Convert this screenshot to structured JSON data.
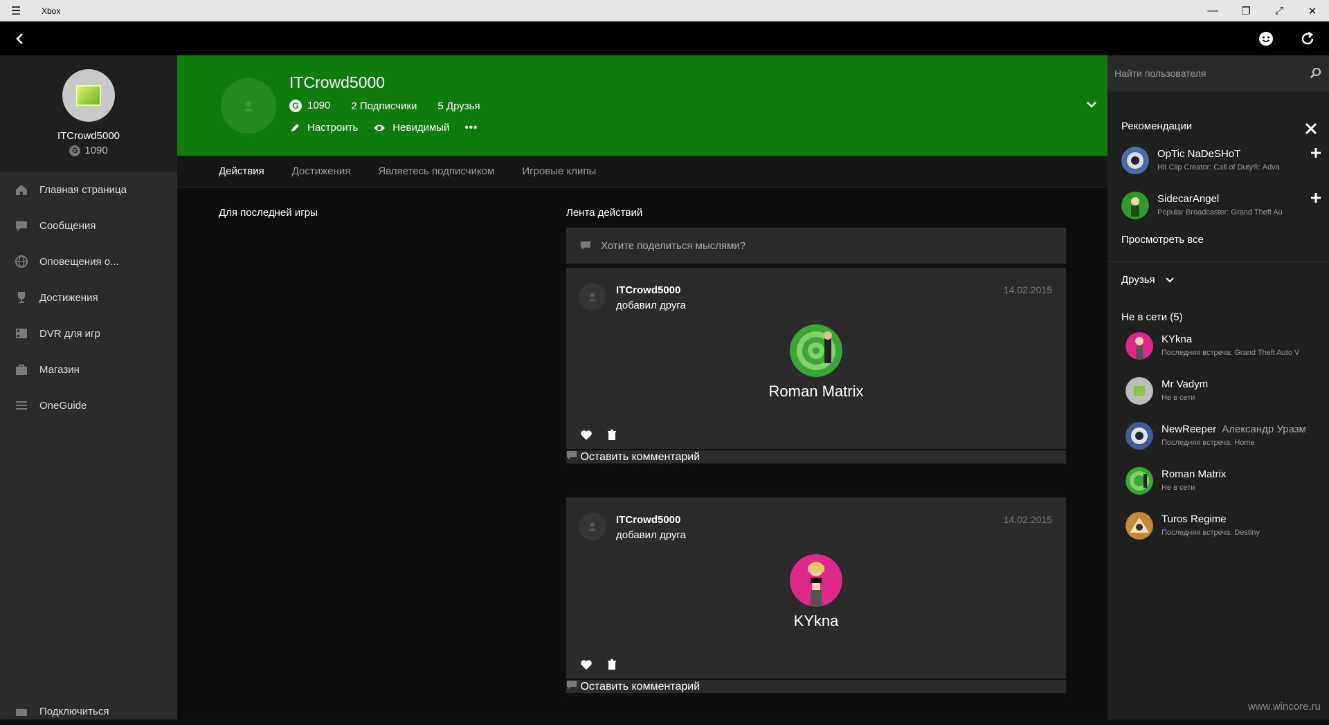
{
  "window": {
    "title": "Xbox",
    "controls": [
      "minimize",
      "restore",
      "maximize",
      "close"
    ]
  },
  "appbar": {
    "icons": [
      "back-icon",
      "smiley-icon",
      "refresh-icon"
    ]
  },
  "profile": {
    "gamertag": "ITCrowd5000",
    "gamerscore": "1090",
    "g_symbol": "G"
  },
  "nav": [
    {
      "label": "Главная страница",
      "icon": "home-icon"
    },
    {
      "label": "Сообщения",
      "icon": "message-icon"
    },
    {
      "label": "Оповещения о...",
      "icon": "globe-icon"
    },
    {
      "label": "Достижения",
      "icon": "trophy-icon"
    },
    {
      "label": "DVR для игр",
      "icon": "dvr-icon"
    },
    {
      "label": "Магазин",
      "icon": "store-icon"
    },
    {
      "label": "OneGuide",
      "icon": "guide-icon"
    }
  ],
  "nav_bottom": {
    "label": "Подключиться"
  },
  "banner": {
    "gamertag": "ITCrowd5000",
    "gamerscore": "1090",
    "followers": "2 Подписчики",
    "friends": "5 Друзья",
    "customize": "Настроить",
    "presence": "Невидимый",
    "more": "•••",
    "color": "#107c10"
  },
  "tabs": [
    {
      "label": "Действия",
      "active": true
    },
    {
      "label": "Достижения",
      "active": false
    },
    {
      "label": "Являетесь подписчиком",
      "active": false
    },
    {
      "label": "Игровые клипы",
      "active": false
    }
  ],
  "left_section": {
    "title": "Для последней игры"
  },
  "feed": {
    "title": "Лента действий",
    "share_placeholder": "Хотите поделиться мыслями?",
    "items": [
      {
        "author": "ITCrowd5000",
        "action": "добавил друга",
        "date": "14.02.2015",
        "friend": "Roman Matrix",
        "comment_placeholder": "Оставить комментарий"
      },
      {
        "author": "ITCrowd5000",
        "action": "добавил друга",
        "date": "14.02.2015",
        "friend": "KYkna",
        "comment_placeholder": "Оставить комментарий"
      }
    ]
  },
  "right": {
    "search_placeholder": "Найти пользователя",
    "recommendations_title": "Рекомендации",
    "recommendations": [
      {
        "name": "OpTic NaDeSHoT",
        "sub": "Hit Clip Creator: Call of Duty®: Adva"
      },
      {
        "name": "SidecarAngel",
        "sub": "Popular Broadcaster: Grand Theft Au"
      }
    ],
    "see_all": "Просмотреть все",
    "friends_label": "Друзья",
    "offline_title": "Не в сети (5)",
    "friends": [
      {
        "name": "KYkna",
        "real": "",
        "sub": "Последняя встреча: Grand Theft Auto V"
      },
      {
        "name": "Mr Vadym",
        "real": "",
        "sub": "Не в сети"
      },
      {
        "name": "NewReeper",
        "real": "Александр Уразм",
        "sub": "Последняя встреча: Home"
      },
      {
        "name": "Roman Matrix",
        "real": "",
        "sub": "Не в сети"
      },
      {
        "name": "Turos Regime",
        "real": "",
        "sub": "Последняя встреча: Destiny"
      }
    ]
  },
  "watermark": "www.wincore.ru"
}
